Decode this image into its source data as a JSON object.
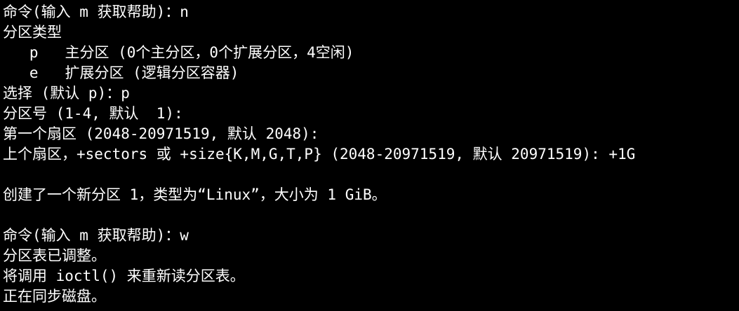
{
  "terminal": {
    "lines": [
      "命令(输入 m 获取帮助)：n",
      "分区类型",
      "   p   主分区 (0个主分区，0个扩展分区，4空闲)",
      "   e   扩展分区 (逻辑分区容器)",
      "选择 (默认 p)：p",
      "分区号 (1-4, 默认  1):",
      "第一个扇区 (2048-20971519, 默认 2048):",
      "上个扇区，+sectors 或 +size{K,M,G,T,P} (2048-20971519, 默认 20971519): +1G",
      "",
      "创建了一个新分区 1，类型为“Linux”，大小为 1 GiB。",
      "",
      "命令(输入 m 获取帮助)：w",
      "分区表已调整。",
      "将调用 ioctl() 来重新读分区表。",
      "正在同步磁盘。"
    ]
  },
  "colors": {
    "background": "#000000",
    "foreground": "#ffffff"
  }
}
